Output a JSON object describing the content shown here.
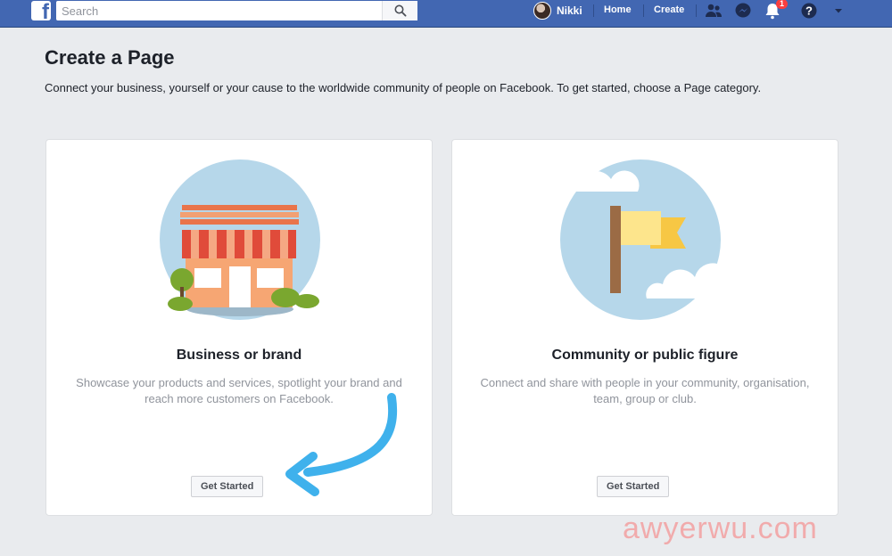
{
  "header": {
    "search_placeholder": "Search",
    "user_name": "Nikki",
    "home_label": "Home",
    "create_label": "Create",
    "notification_count": "1",
    "brand_color": "#4267b2",
    "icons": [
      "facebook-logo-icon",
      "search-icon",
      "friends-icon",
      "messenger-icon",
      "notifications-icon",
      "help-icon",
      "caret-down-icon"
    ]
  },
  "page": {
    "title": "Create a Page",
    "subtitle": "Connect your business, yourself or your cause to the worldwide community of people on Facebook. To get started, choose a Page category."
  },
  "cards": [
    {
      "title": "Business or brand",
      "description": "Showcase your products and services, spotlight your brand and reach more customers on Facebook.",
      "button": "Get Started",
      "illustration": "storefront-icon"
    },
    {
      "title": "Community or public figure",
      "description": "Connect and share with people in your community, organisation, team, group or club.",
      "button": "Get Started",
      "illustration": "flag-icon"
    }
  ],
  "annotation": {
    "arrow_color": "#3fb1ec"
  },
  "watermark": "awyerwu.com"
}
